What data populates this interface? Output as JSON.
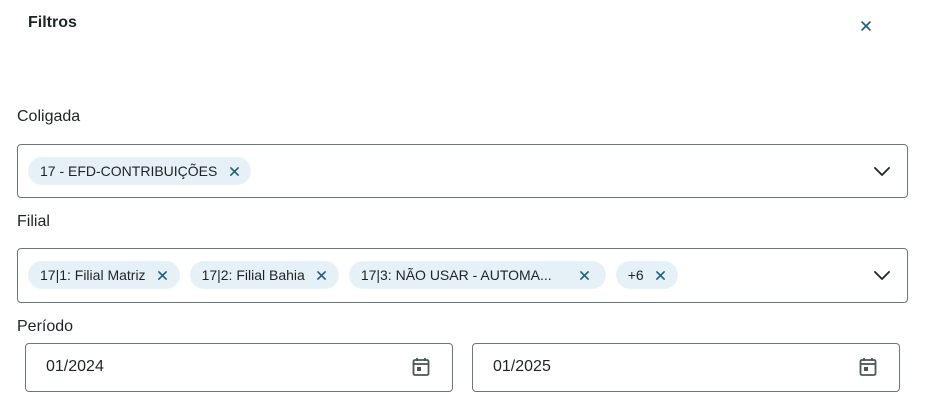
{
  "header": {
    "title": "Filtros",
    "close_icon": "close-icon"
  },
  "coligada": {
    "label": "Coligada",
    "chips": [
      "17 - EFD-CONTRIBUIÇÕES"
    ]
  },
  "filial": {
    "label": "Filial",
    "chips": [
      "17|1: Filial Matriz",
      "17|2: Filial Bahia",
      "17|3: NÃO USAR - AUTOMA...",
      "+6"
    ]
  },
  "periodo": {
    "label": "Período",
    "start": "01/2024",
    "end": "01/2025"
  },
  "colors": {
    "chip_bg": "#e6f1f7",
    "icon": "#1d5e86",
    "border": "#6b7777"
  }
}
